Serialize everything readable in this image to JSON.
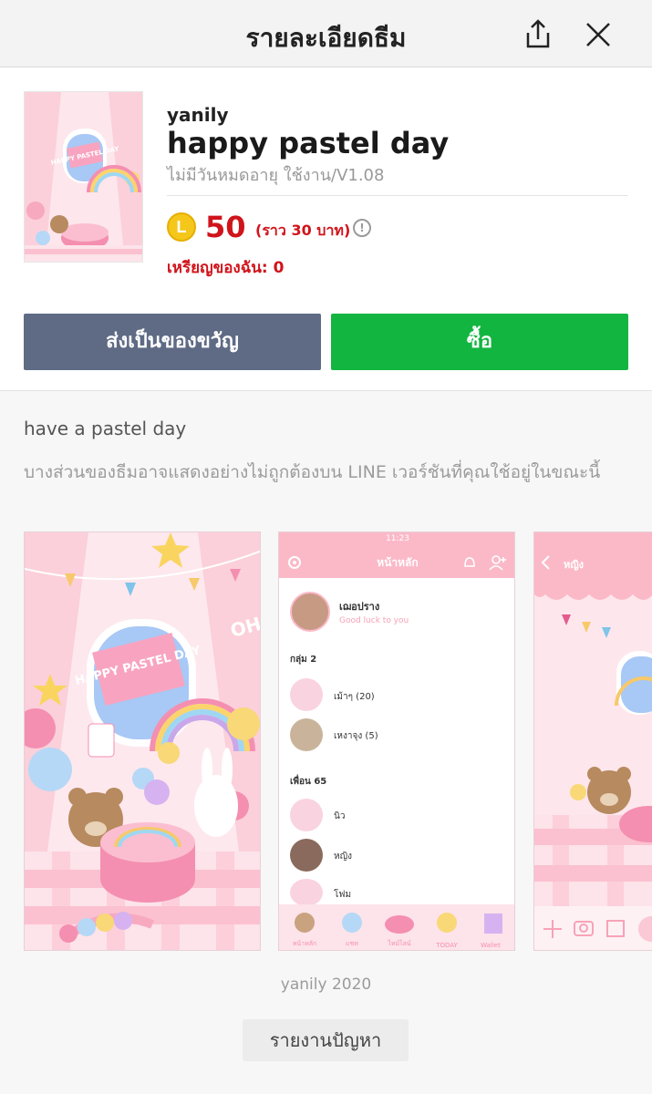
{
  "header": {
    "title": "รายละเอียดธีม",
    "share_icon": "share-icon",
    "close_icon": "close-icon"
  },
  "theme": {
    "author": "yanily",
    "title": "happy pastel day",
    "subtitle": "ไม่มีวันหมดอายุ ใช้งาน/V1.08",
    "coin_symbol": "L",
    "price": "50",
    "price_approx": "(ราว 30 บาท)",
    "info_icon": "!",
    "my_coins": "เหรียญของฉัน: 0",
    "thumbnail_text": "HAPPY PASTEL DAY"
  },
  "actions": {
    "gift_label": "ส่งเป็นของขวัญ",
    "buy_label": "ซื้อ"
  },
  "description": {
    "text": "have a pastel day",
    "warning": "บางส่วนของธีมอาจแสดงอย่างไม่ถูกต้องบน LINE เวอร์ชันที่คุณใช้อยู่ในขณะนี้"
  },
  "preview1": {
    "sign_text": "HAPPY PASTEL DAY",
    "oh_text": "OH"
  },
  "preview2": {
    "status_time": "11:23",
    "nav_title": "หน้าหลัก",
    "profile_name": "เฌอปราง",
    "profile_status": "Good luck to you",
    "groups_header": "กลุ่ม 2",
    "groups": [
      {
        "name": "เม้าๆ (20)"
      },
      {
        "name": "เหงาจุง (5)"
      }
    ],
    "friends_header": "เพื่อน 65",
    "friends": [
      {
        "name": "นิว"
      },
      {
        "name": "หญิง"
      },
      {
        "name": "โฟม"
      }
    ],
    "tabs": [
      "หน้าหลัก",
      "แชท",
      "ไทม์ไลน์",
      "TODAY",
      "Wallet"
    ]
  },
  "preview3": {
    "chat_title": "หญิง"
  },
  "footer": {
    "copyright": "yanily 2020",
    "report_label": "รายงานปัญหา"
  }
}
